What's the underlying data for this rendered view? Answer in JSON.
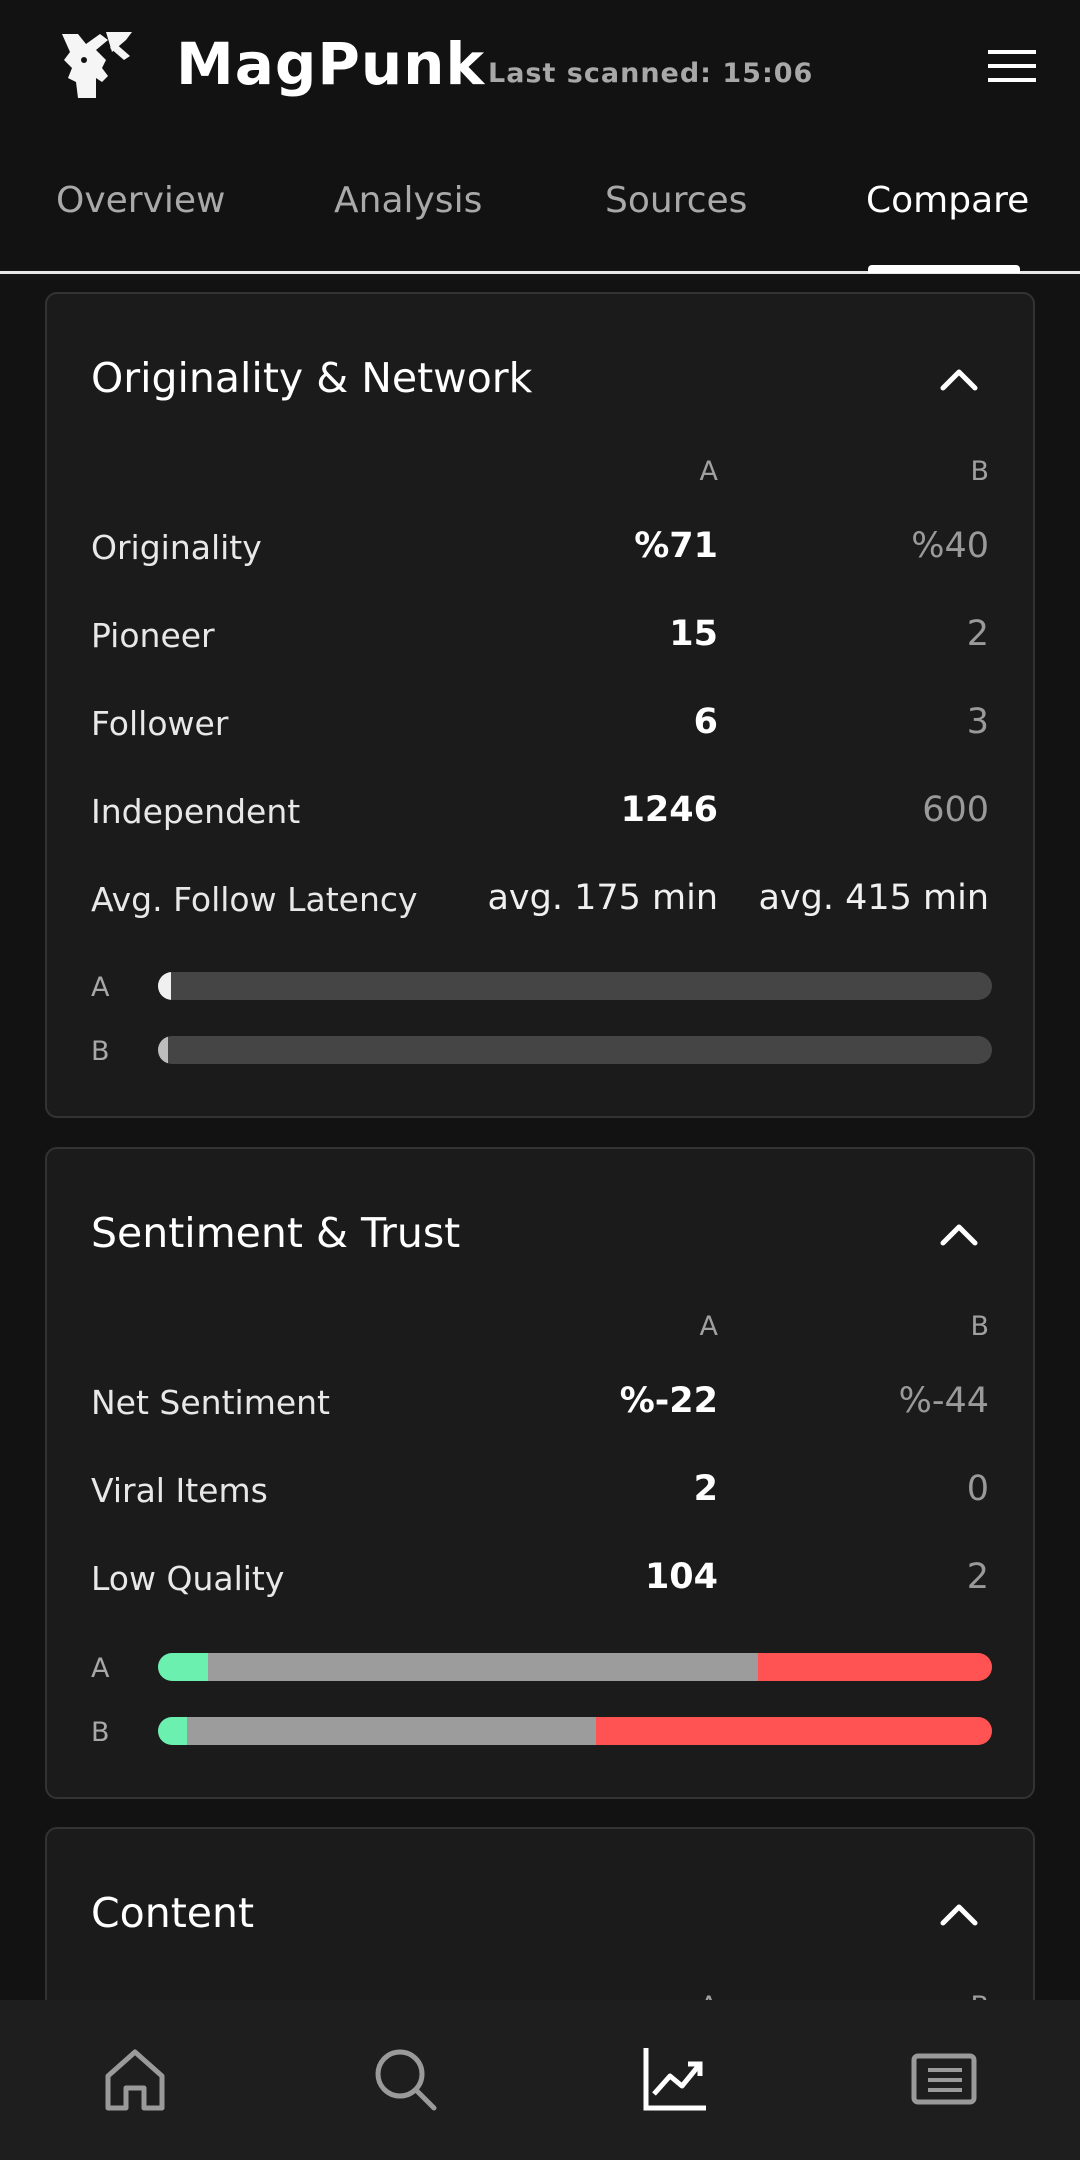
{
  "header": {
    "app_title": "MagPunk",
    "last_scanned": "Last scanned: 15:06",
    "logo_icon": "goat-logo-icon",
    "menu_icon": "hamburger-menu-icon"
  },
  "tabs": [
    {
      "label": "Overview",
      "active": false
    },
    {
      "label": "Analysis",
      "active": false
    },
    {
      "label": "Sources",
      "active": false
    },
    {
      "label": "Compare",
      "active": true
    }
  ],
  "columns": {
    "a": "A",
    "b": "B"
  },
  "sections": {
    "originality": {
      "title": "Originality & Network",
      "rows": [
        {
          "label": "Originality",
          "a": "%71",
          "b": "%40"
        },
        {
          "label": "Pioneer",
          "a": "15",
          "b": "2"
        },
        {
          "label": "Follower",
          "a": "6",
          "b": "3"
        },
        {
          "label": "Independent",
          "a": "1246",
          "b": "600"
        },
        {
          "label": "Avg. Follow Latency",
          "a": "avg. 175 min",
          "b": "avg. 415 min"
        }
      ],
      "bars": [
        {
          "label": "A",
          "fill_fraction": 0.015,
          "fill_color": "#f0f0f0"
        },
        {
          "label": "B",
          "fill_fraction": 0.005,
          "fill_color": "#bdbdbd"
        }
      ]
    },
    "sentiment": {
      "title": "Sentiment & Trust",
      "rows": [
        {
          "label": "Net Sentiment",
          "a": "%-22",
          "b": "%-44"
        },
        {
          "label": "Viral Items",
          "a": "2",
          "b": "0"
        },
        {
          "label": "Low Quality",
          "a": "104",
          "b": "2"
        }
      ],
      "bars": [
        {
          "label": "A",
          "positive": 0.06,
          "neutral": 0.66,
          "negative": 0.28
        },
        {
          "label": "B",
          "positive": 0.035,
          "neutral": 0.49,
          "negative": 0.475
        }
      ]
    },
    "content": {
      "title": "Content"
    }
  },
  "colors": {
    "positive": "#6cf0b0",
    "neutral": "#9c9c9c",
    "negative": "#ff5252",
    "track": "#454545"
  },
  "bottom_nav": [
    {
      "icon": "home-icon",
      "active": false
    },
    {
      "icon": "search-icon",
      "active": false
    },
    {
      "icon": "chart-trend-icon",
      "active": true
    },
    {
      "icon": "newspaper-icon",
      "active": false
    }
  ]
}
